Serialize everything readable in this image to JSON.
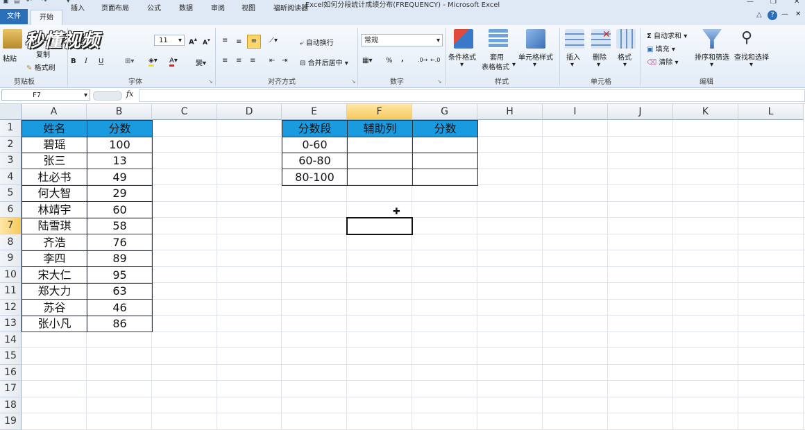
{
  "window": {
    "title": "Excel如何分段统计成绩分布(FREQUENCY) - Microsoft Excel"
  },
  "tabs": [
    "文件",
    "开始",
    "插入",
    "页面布局",
    "公式",
    "数据",
    "审阅",
    "视图",
    "福昕阅读器"
  ],
  "watermark": "秒懂视频",
  "ribbon": {
    "clipboard": {
      "paste": "粘贴",
      "copy": "复制",
      "format_painter": "格式刷",
      "group": "剪贴板"
    },
    "font": {
      "size": "11",
      "bold": "B",
      "italic": "I",
      "underline": "U",
      "group": "字体"
    },
    "align": {
      "wrap": "自动换行",
      "merge": "合并后居中",
      "group": "对齐方式"
    },
    "number": {
      "format": "常规",
      "percent": "%",
      "comma": ",",
      "group": "数字"
    },
    "styles": {
      "cond": "条件格式",
      "table1": "套用",
      "table2": "表格格式",
      "cell": "单元格样式",
      "group": "样式"
    },
    "cells": {
      "insert": "插入",
      "delete": "删除",
      "format": "格式",
      "group": "单元格"
    },
    "editing": {
      "autosum": "自动求和",
      "fill": "填充",
      "clear": "清除",
      "sort": "排序和筛选",
      "find": "查找和选择",
      "group": "编辑"
    }
  },
  "formula_bar": {
    "name_box": "F7",
    "fx": "fx",
    "formula": ""
  },
  "columns": [
    "A",
    "B",
    "C",
    "D",
    "E",
    "F",
    "G",
    "H",
    "I",
    "J",
    "K",
    "L"
  ],
  "rows": [
    "1",
    "2",
    "3",
    "4",
    "5",
    "6",
    "7",
    "8",
    "9",
    "10",
    "11",
    "12",
    "13",
    "14",
    "15",
    "16",
    "17",
    "18",
    "19"
  ],
  "table1": {
    "headers": [
      "姓名",
      "分数"
    ],
    "rows": [
      [
        "碧瑶",
        "100"
      ],
      [
        "张三",
        "13"
      ],
      [
        "杜必书",
        "49"
      ],
      [
        "何大智",
        "29"
      ],
      [
        "林靖宇",
        "60"
      ],
      [
        "陆雪琪",
        "58"
      ],
      [
        "齐浩",
        "76"
      ],
      [
        "李四",
        "89"
      ],
      [
        "宋大仁",
        "95"
      ],
      [
        "郑大力",
        "63"
      ],
      [
        "苏谷",
        "46"
      ],
      [
        "张小凡",
        "86"
      ]
    ]
  },
  "table2": {
    "headers": [
      "分数段",
      "辅助列",
      "分数"
    ],
    "rows": [
      [
        "0-60",
        "",
        ""
      ],
      [
        "60-80",
        "",
        ""
      ],
      [
        "80-100",
        "",
        ""
      ]
    ]
  },
  "selected_cell": "F7",
  "colors": {
    "header_fill": "#1a9be0",
    "accent": "#2a6fb8"
  }
}
